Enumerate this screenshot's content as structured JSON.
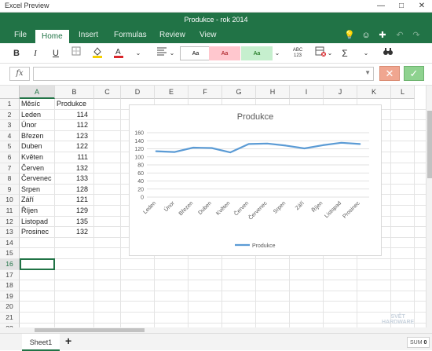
{
  "window": {
    "app_title": "Excel Preview",
    "document_title": "Produkce - rok 2014",
    "controls": [
      "—",
      "□",
      "✕"
    ]
  },
  "ribbon": {
    "tabs": [
      {
        "label": "File",
        "active": false
      },
      {
        "label": "Home",
        "active": true
      },
      {
        "label": "Insert",
        "active": false
      },
      {
        "label": "Formulas",
        "active": false
      },
      {
        "label": "Review",
        "active": false
      },
      {
        "label": "View",
        "active": false
      }
    ],
    "right_icons": [
      "lightbulb-icon",
      "smiley-icon",
      "share-icon",
      "undo-icon",
      "redo-icon"
    ]
  },
  "toolbar": {
    "bold": "B",
    "italic": "I",
    "underline": "U",
    "cell_styles": [
      {
        "label": "Aa",
        "bg": "#ffffff"
      },
      {
        "label": "Aa",
        "bg": "#ffc7ce"
      },
      {
        "label": "Aa",
        "bg": "#c6efce"
      }
    ],
    "number_format_label": "ABC 123",
    "sum_symbol": "Σ"
  },
  "formula_bar": {
    "fx_label": "fx",
    "value": "",
    "cancel_symbol": "✕",
    "confirm_symbol": "✓"
  },
  "grid": {
    "columns": [
      "A",
      "B",
      "C",
      "D",
      "E",
      "F",
      "G",
      "H",
      "I",
      "J",
      "K",
      "L"
    ],
    "selected_column": "A",
    "row_numbers": [
      "1",
      "2",
      "3",
      "4",
      "5",
      "6",
      "7",
      "8",
      "9",
      "10",
      "11",
      "12",
      "13",
      "14",
      "15",
      "16",
      "17",
      "18",
      "19",
      "20",
      "21",
      "22"
    ],
    "selected_row": "16",
    "header_a": "Měsíc",
    "header_b": "Produkce",
    "rows": [
      {
        "month": "Leden",
        "value": "114"
      },
      {
        "month": "Únor",
        "value": "112"
      },
      {
        "month": "Březen",
        "value": "123"
      },
      {
        "month": "Duben",
        "value": "122"
      },
      {
        "month": "Květen",
        "value": "111"
      },
      {
        "month": "Červen",
        "value": "132"
      },
      {
        "month": "Červenec",
        "value": "133"
      },
      {
        "month": "Srpen",
        "value": "128"
      },
      {
        "month": "Září",
        "value": "121"
      },
      {
        "month": "Říjen",
        "value": "129"
      },
      {
        "month": "Listopad",
        "value": "135"
      },
      {
        "month": "Prosinec",
        "value": "132"
      }
    ]
  },
  "chart_data": {
    "type": "line",
    "title": "Produkce",
    "categories": [
      "Leden",
      "Únor",
      "Březen",
      "Duben",
      "Květen",
      "Červen",
      "Červenec",
      "Srpen",
      "Září",
      "Říjen",
      "Listopad",
      "Prosinec"
    ],
    "series": [
      {
        "name": "Produkce",
        "values": [
          114,
          112,
          123,
          122,
          111,
          132,
          133,
          128,
          121,
          129,
          135,
          132
        ],
        "color": "#5b9bd5"
      }
    ],
    "ylim": [
      0,
      160
    ],
    "yticks": [
      0,
      20,
      40,
      60,
      80,
      100,
      120,
      140,
      160
    ],
    "grid": true,
    "legend": "bottom"
  },
  "status": {
    "sheet_name": "Sheet1",
    "add_sheet": "+",
    "sum_label": "SUM",
    "sum_value": "0"
  },
  "watermark": {
    "line1": "SVĚT",
    "line2": "HARDWARE"
  },
  "colors": {
    "accent": "#217346",
    "series": "#5b9bd5"
  }
}
